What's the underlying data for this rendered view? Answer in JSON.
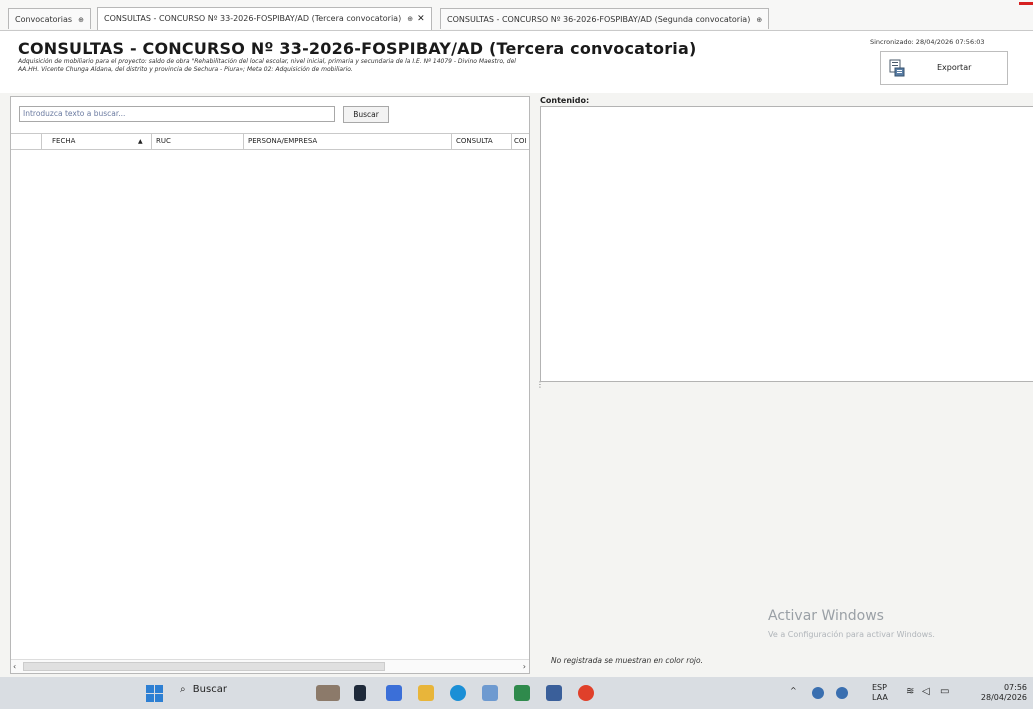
{
  "tabs": [
    {
      "label": "Convocatorias",
      "pin": "⊕",
      "close": ""
    },
    {
      "label": "CONSULTAS  - CONCURSO Nº 33-2026-FOSPIBAY/AD (Tercera convocatoria)",
      "pin": "⊕",
      "close": "✕"
    },
    {
      "label": "CONSULTAS  - CONCURSO Nº 36-2026-FOSPIBAY/AD (Segunda convocatoria)",
      "pin": "⊕",
      "close": ""
    }
  ],
  "header": {
    "title": "CONSULTAS  - CONCURSO Nº 33-2026-FOSPIBAY/AD (Tercera convocatoria)",
    "subtitle": "Adquisición de mobiliario para el proyecto: saldo de obra \"Rehabilitación del local escolar, nivel inicial, primaria y secundaria de la I.E. Nº 14079 - Divino Maestro, del AA.HH. Vicente Chunga Aldana, del distrito y provincia de Sechura - Piura»; Meta 02: Adquisición de mobiliario.",
    "sync": "Sincronizado: 28/04/2026 07:56:03",
    "export_label": "Exportar"
  },
  "search": {
    "placeholder": "Introduzca texto a buscar...",
    "button": "Buscar"
  },
  "grid": {
    "columns": [
      "",
      "FECHA",
      "RUC",
      "PERSONA/EMPRESA",
      "CONSULTA",
      "COI"
    ],
    "sort_indicator": "▲"
  },
  "content": {
    "label": "Contenido:"
  },
  "note": "No registrada se muestran en color rojo.",
  "watermark": {
    "line1": "Activar Windows",
    "line2": "Ve a Configuración para activar Windows."
  },
  "taskbar": {
    "search": "Buscar",
    "lang1": "ESP",
    "lang2": "LAA",
    "time": "07:56",
    "date": "28/04/2026",
    "tray_arrow": "^"
  },
  "colors": {
    "accent": "#2d7fd3",
    "note_red": "#d62020"
  }
}
